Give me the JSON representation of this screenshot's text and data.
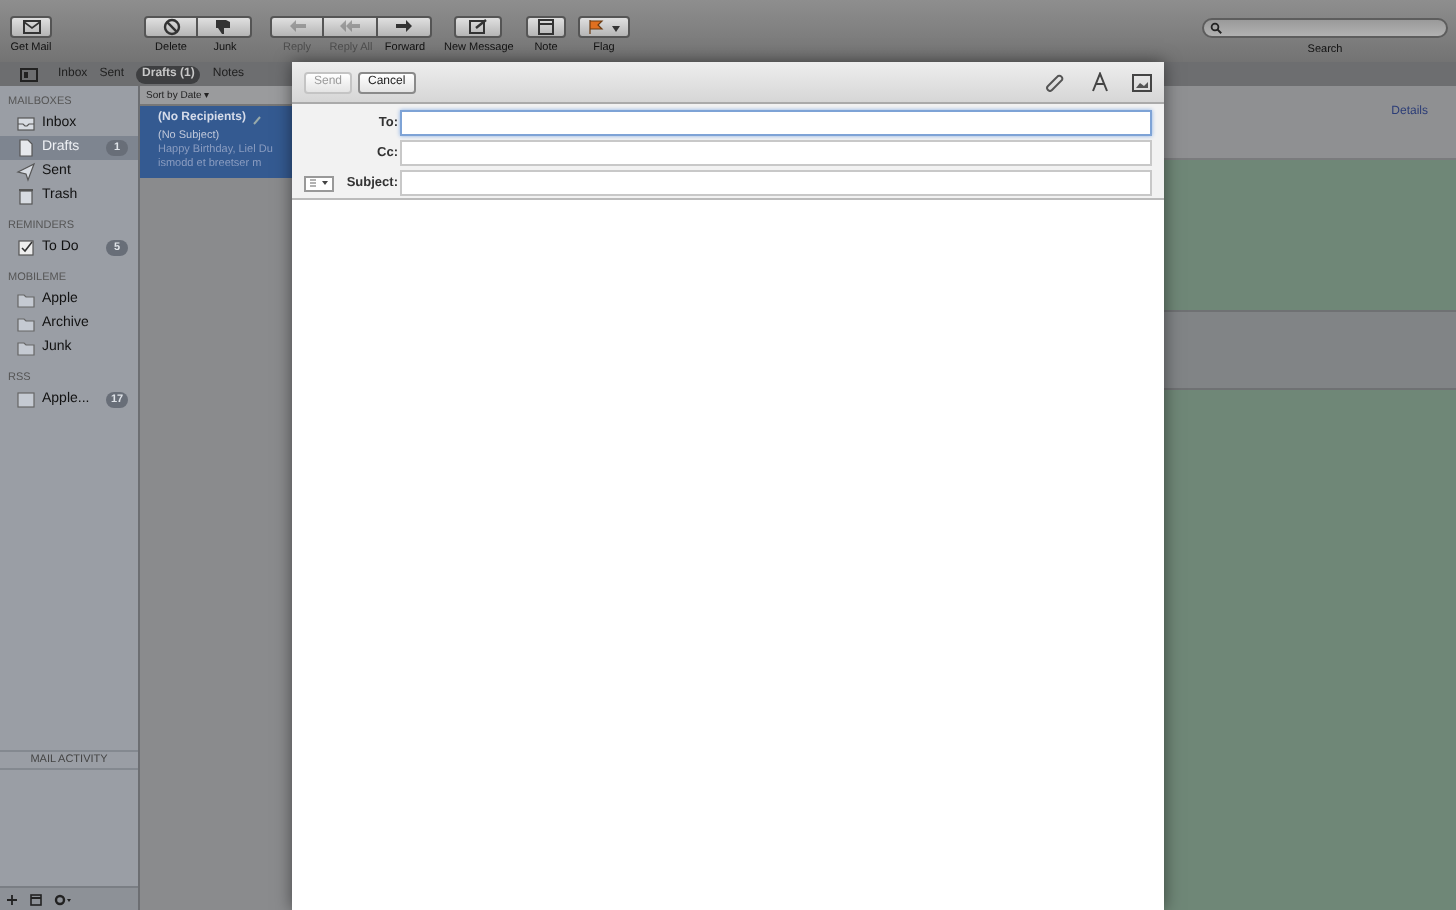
{
  "toolbar": {
    "buttons": [
      {
        "kind": "getmail",
        "label": "Get Mail",
        "disabled": false
      },
      {
        "kind": "delete",
        "label": "Delete",
        "disabled": false
      },
      {
        "kind": "junk",
        "label": "Junk",
        "disabled": false
      },
      {
        "kind": "reply",
        "label": "Reply",
        "disabled": true
      },
      {
        "kind": "replyall",
        "label": "Reply All",
        "disabled": true
      },
      {
        "kind": "forward",
        "label": "Forward",
        "disabled": false
      },
      {
        "kind": "new",
        "label": "New Message",
        "disabled": false
      },
      {
        "kind": "note",
        "label": "Note",
        "disabled": false
      },
      {
        "kind": "flag",
        "label": "Flag",
        "disabled": false
      }
    ],
    "search": {
      "label": "Search"
    }
  },
  "favorites": [
    {
      "label": "Inbox",
      "selected": false
    },
    {
      "label": "Sent",
      "selected": false
    },
    {
      "label": "Drafts (1)",
      "selected": true
    },
    {
      "label": "Notes",
      "selected": false
    }
  ],
  "sidebar": {
    "sections": [
      {
        "title": "MAILBOXES",
        "items": [
          {
            "kind": "inbox",
            "label": "Inbox",
            "selected": false
          },
          {
            "kind": "drafts",
            "label": "Drafts",
            "badge": "1",
            "selected": true
          },
          {
            "kind": "sent",
            "label": "Sent",
            "selected": false
          },
          {
            "kind": "trash",
            "label": "Trash",
            "selected": false
          }
        ]
      },
      {
        "title": "REMINDERS",
        "items": [
          {
            "kind": "todo",
            "label": "To Do",
            "badge": "5",
            "selected": false
          }
        ]
      },
      {
        "title": "MOBILEME",
        "items": [
          {
            "kind": "folder",
            "label": "Apple",
            "selected": false
          },
          {
            "kind": "folder",
            "label": "Archive",
            "selected": false
          },
          {
            "kind": "folder",
            "label": "Junk",
            "selected": false
          }
        ]
      },
      {
        "title": "RSS",
        "items": [
          {
            "kind": "rss",
            "label": "Apple...",
            "badge": "17",
            "selected": false
          }
        ]
      }
    ],
    "activity": "MAIL ACTIVITY"
  },
  "message_list": {
    "sort": "Sort by Date ▾",
    "messages": [
      {
        "from": "(No Recipients)",
        "subject": "(No Subject)",
        "preview": [
          "Happy Birthday, Liel Du",
          "ismodd et breetser m"
        ],
        "selected": true
      }
    ]
  },
  "detail": {
    "link": "Details"
  },
  "compose": {
    "buttons": [
      {
        "label": "Send",
        "disabled": true
      },
      {
        "label": "Cancel",
        "disabled": false
      }
    ],
    "fields": [
      {
        "label": "To:",
        "focused": true
      },
      {
        "label": "Cc:",
        "focused": false
      },
      {
        "label": "Subject:",
        "focused": false
      }
    ]
  }
}
